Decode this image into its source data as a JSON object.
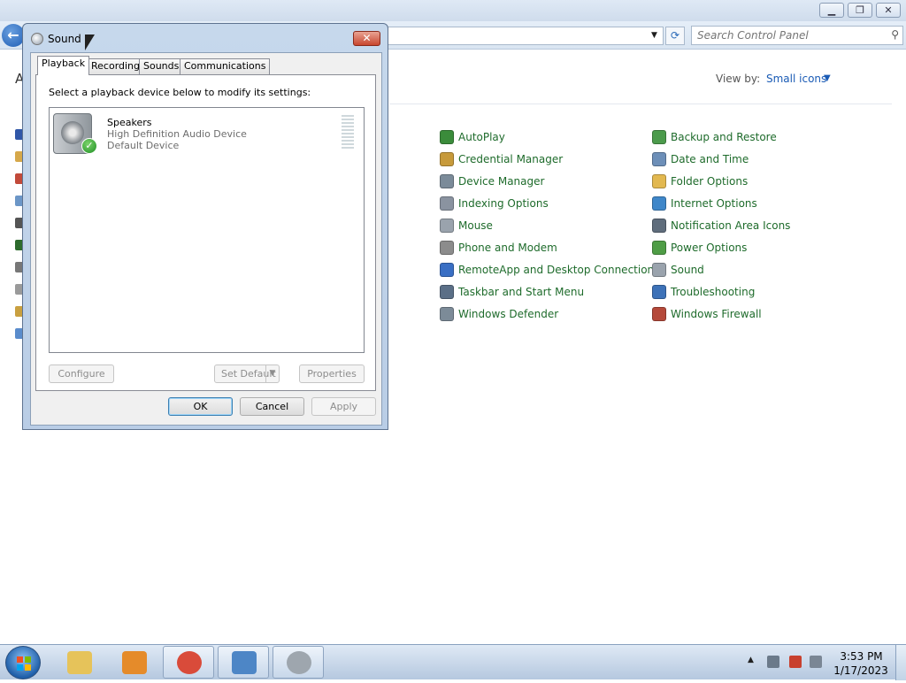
{
  "control_panel": {
    "search_placeholder": "Search Control Panel",
    "view_by_label": "View by:",
    "view_by_value": "Small icons",
    "left_letter": "A",
    "items_col1": [
      {
        "label": "AutoPlay",
        "icon": "autoplay-icon",
        "color": "#3b8c3b"
      },
      {
        "label": "Credential Manager",
        "icon": "credential-manager-icon",
        "color": "#c79a3b"
      },
      {
        "label": "Device Manager",
        "icon": "device-manager-icon",
        "color": "#7b8b99"
      },
      {
        "label": "Indexing Options",
        "icon": "indexing-options-icon",
        "color": "#8a93a0"
      },
      {
        "label": "Mouse",
        "icon": "mouse-icon",
        "color": "#9aa3ad"
      },
      {
        "label": "Phone and Modem",
        "icon": "phone-modem-icon",
        "color": "#8c8c8c"
      },
      {
        "label": "RemoteApp and Desktop Connections",
        "icon": "remoteapp-icon",
        "color": "#3a6fc4"
      },
      {
        "label": "Taskbar and Start Menu",
        "icon": "taskbar-icon",
        "color": "#5b6f87"
      },
      {
        "label": "Windows Defender",
        "icon": "windows-defender-icon",
        "color": "#7c8b98"
      }
    ],
    "items_col2": [
      {
        "label": "Backup and Restore",
        "icon": "backup-restore-icon",
        "color": "#4c9b4c"
      },
      {
        "label": "Date and Time",
        "icon": "date-time-icon",
        "color": "#6d8fb8"
      },
      {
        "label": "Folder Options",
        "icon": "folder-options-icon",
        "color": "#e2b850"
      },
      {
        "label": "Internet Options",
        "icon": "internet-options-icon",
        "color": "#3f87c9"
      },
      {
        "label": "Notification Area Icons",
        "icon": "notification-area-icon",
        "color": "#5f6d7c"
      },
      {
        "label": "Power Options",
        "icon": "power-options-icon",
        "color": "#4f9d46"
      },
      {
        "label": "Sound",
        "icon": "sound-icon",
        "color": "#9aa3ad"
      },
      {
        "label": "Troubleshooting",
        "icon": "troubleshooting-icon",
        "color": "#3d72b8"
      },
      {
        "label": "Windows Firewall",
        "icon": "windows-firewall-icon",
        "color": "#b5493a"
      }
    ]
  },
  "dialog": {
    "title": "Sound",
    "close_glyph": "✕",
    "tabs": [
      "Playback",
      "Recording",
      "Sounds",
      "Communications"
    ],
    "active_tab": "Playback",
    "prompt": "Select a playback device below to modify its settings:",
    "device": {
      "name": "Speakers",
      "description": "High Definition Audio Device",
      "status": "Default Device"
    },
    "buttons": {
      "configure": "Configure",
      "set_default": "Set Default",
      "properties": "Properties",
      "ok": "OK",
      "cancel": "Cancel",
      "apply": "Apply"
    }
  },
  "taskbar": {
    "apps": [
      {
        "name": "explorer",
        "icon": "file-explorer-icon",
        "color": "#e6c35a"
      },
      {
        "name": "media-player",
        "icon": "media-player-icon",
        "color": "#e58b2a"
      },
      {
        "name": "chrome",
        "icon": "chrome-icon",
        "color": "#d94b3a"
      },
      {
        "name": "control-panel",
        "icon": "control-panel-icon",
        "color": "#4d86c6"
      },
      {
        "name": "sound",
        "icon": "sound-taskbar-icon",
        "color": "#9ea6ae"
      }
    ],
    "clock_time": "3:53 PM",
    "clock_date": "1/17/2023"
  }
}
